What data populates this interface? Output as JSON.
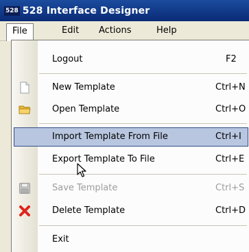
{
  "window": {
    "icon_label": "528",
    "title": "528 Interface Designer"
  },
  "menubar": [
    {
      "label": "File",
      "open": true
    },
    {
      "label": "Edit"
    },
    {
      "label": "Actions"
    },
    {
      "label": "Help"
    }
  ],
  "file_menu": {
    "items": [
      {
        "label": "Logout",
        "shortcut": "F2",
        "icon": null,
        "state": "normal"
      },
      {
        "label": "New Template",
        "shortcut": "Ctrl+N",
        "icon": "new-document-icon",
        "state": "normal"
      },
      {
        "label": "Open Template",
        "shortcut": "Ctrl+O",
        "icon": "open-folder-icon",
        "state": "normal"
      },
      {
        "label": "Import Template From File",
        "shortcut": "Ctrl+I",
        "icon": null,
        "state": "highlighted"
      },
      {
        "label": "Export Template To File",
        "shortcut": "Ctrl+E",
        "icon": null,
        "state": "normal"
      },
      {
        "label": "Save Template",
        "shortcut": "Ctrl+S",
        "icon": "save-disk-icon",
        "state": "disabled"
      },
      {
        "label": "Delete Template",
        "shortcut": "Ctrl+D",
        "icon": "delete-x-icon",
        "state": "normal"
      },
      {
        "label": "Exit",
        "shortcut": "",
        "icon": null,
        "state": "normal"
      }
    ]
  },
  "colors": {
    "titlebar": "#0a2a75",
    "highlight_fill": "#b8c6e0",
    "highlight_border": "#324f86",
    "delete_icon": "#e0241b",
    "folder_icon": "#f2c94c"
  }
}
